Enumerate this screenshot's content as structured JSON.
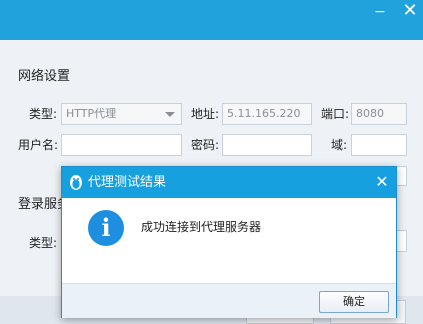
{
  "window": {
    "minimize_glyph": "−",
    "close_glyph": "✕"
  },
  "network": {
    "section_title": "网络设置",
    "type_label": "类型:",
    "type_value": "HTTP代理",
    "address_label": "地址:",
    "address_value": "5.11.165.220",
    "port_label": "端口:",
    "port_value": "8080",
    "username_label": "用户名:",
    "username_value": "",
    "password_label": "密码:",
    "password_value": "",
    "domain_label": "域:",
    "domain_value": ""
  },
  "login_server": {
    "section_title": "登录服务",
    "type_label": "类型:"
  },
  "dialog": {
    "title": "代理测试结果",
    "close_glyph": "✕",
    "info_glyph": "i",
    "message": "成功连接到代理服务器",
    "ok_label": "确定"
  },
  "colors": {
    "titlebar": "#22a2dd",
    "dialog_titlebar": "#16a0e0",
    "info_icon": "#1e8fe0"
  }
}
